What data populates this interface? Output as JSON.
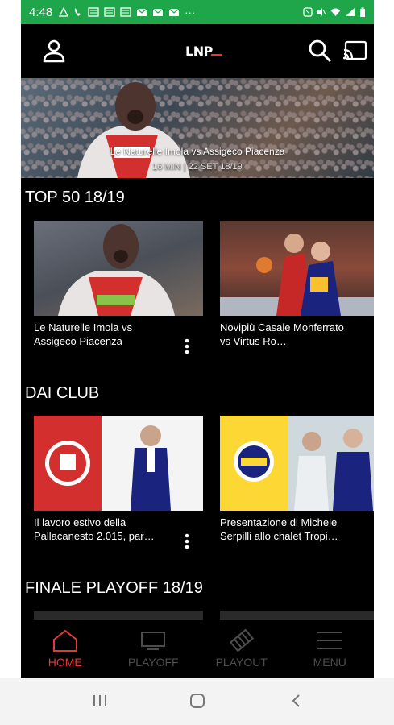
{
  "status_bar": {
    "time": "4:48"
  },
  "app": {
    "logo_text": "LNP"
  },
  "hero": {
    "title": "Le Naturelle Imola vs Assigeco Piacenza",
    "subtitle": "16 MIN | 22 SET 18/19"
  },
  "sections": [
    {
      "title": "TOP 50 18/19",
      "cards": [
        {
          "title": "Le Naturelle Imola vs Assigeco Piacenza"
        },
        {
          "title": "Novipiù Casale Monferrato vs Virtus Ro…"
        }
      ]
    },
    {
      "title": "DAI CLUB",
      "cards": [
        {
          "title": "Il lavoro estivo della Pallacanesto 2.015, par…"
        },
        {
          "title": "Presentazione di Michele Serpilli allo chalet Tropi…"
        }
      ]
    },
    {
      "title": "FINALE PLAYOFF 18/19"
    }
  ],
  "bottom_nav": [
    {
      "label": "HOME",
      "icon": "home-icon",
      "active": true
    },
    {
      "label": "PLAYOFF",
      "icon": "tv-icon",
      "active": false
    },
    {
      "label": "PLAYOUT",
      "icon": "film-icon",
      "active": false
    },
    {
      "label": "MENU",
      "icon": "menu-icon",
      "active": false
    }
  ],
  "colors": {
    "status_bar": "#1fa64a",
    "accent": "#e53935",
    "background": "#000000"
  }
}
